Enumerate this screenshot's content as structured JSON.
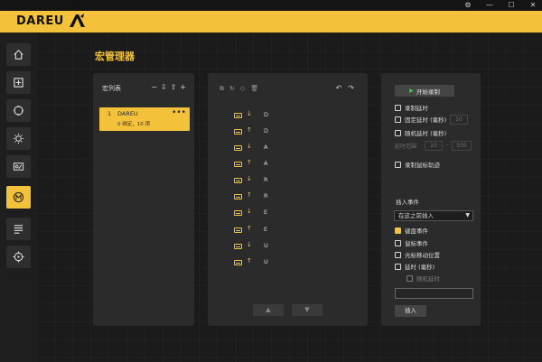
{
  "window": {
    "settings_icon": "⚙",
    "minimize": "—",
    "maximize": "☐",
    "close": "✕"
  },
  "brand": {
    "logo_text": "DAREU",
    "accent": "#f4c23a"
  },
  "sidebar": {
    "items": [
      {
        "icon": "home-icon"
      },
      {
        "icon": "plus-square-icon"
      },
      {
        "icon": "move-arrows-icon"
      },
      {
        "icon": "brightness-icon"
      },
      {
        "icon": "image-icon"
      },
      {
        "icon": "macro-m-icon",
        "active": true
      },
      {
        "icon": "list-icon"
      },
      {
        "icon": "crosshair-icon"
      }
    ]
  },
  "page": {
    "title": "宏管理器"
  },
  "macro_list": {
    "header": "宏列表",
    "tools": {
      "remove": "−",
      "import": "⇩",
      "export": "⇧",
      "add": "+"
    },
    "items": [
      {
        "index": "1",
        "name": "DAREU",
        "meta": "0 绑定，10 项",
        "more": "•••"
      }
    ]
  },
  "events": {
    "tools": {
      "copy": "⧉",
      "refresh": "↻",
      "tag": "◇",
      "delete": "🗑",
      "undo": "↶",
      "redo": "↷"
    },
    "rows": [
      {
        "dir": "↓",
        "key": "D"
      },
      {
        "dir": "↑",
        "key": "D"
      },
      {
        "dir": "↓",
        "key": "A"
      },
      {
        "dir": "↑",
        "key": "A"
      },
      {
        "dir": "↓",
        "key": "R"
      },
      {
        "dir": "↑",
        "key": "R"
      },
      {
        "dir": "↓",
        "key": "E"
      },
      {
        "dir": "↑",
        "key": "E"
      },
      {
        "dir": "↓",
        "key": "U"
      },
      {
        "dir": "↑",
        "key": "U"
      }
    ],
    "scroll_up": "▲",
    "scroll_down": "▼"
  },
  "recording": {
    "start_label": "开始录制",
    "options": {
      "record_delay": "录制延时",
      "fixed_delay": "固定延时 (毫秒)",
      "fixed_delay_value": "10",
      "random_delay": "随机延时 (毫秒)",
      "delay_range_label": "延时范围",
      "delay_min": "10",
      "delay_max": "500",
      "record_mouse_track": "录制鼠标轨迹"
    }
  },
  "insert": {
    "title": "插入事件",
    "position_select": "在这之前插入",
    "options": [
      {
        "label": "键盘事件",
        "checked": true
      },
      {
        "label": "鼠标事件",
        "checked": false
      },
      {
        "label": "光标移动位置",
        "checked": false
      },
      {
        "label": "延时 (毫秒)",
        "checked": false
      },
      {
        "label": "随机延时",
        "checked": false,
        "disabled": true
      }
    ],
    "button": "插入"
  }
}
